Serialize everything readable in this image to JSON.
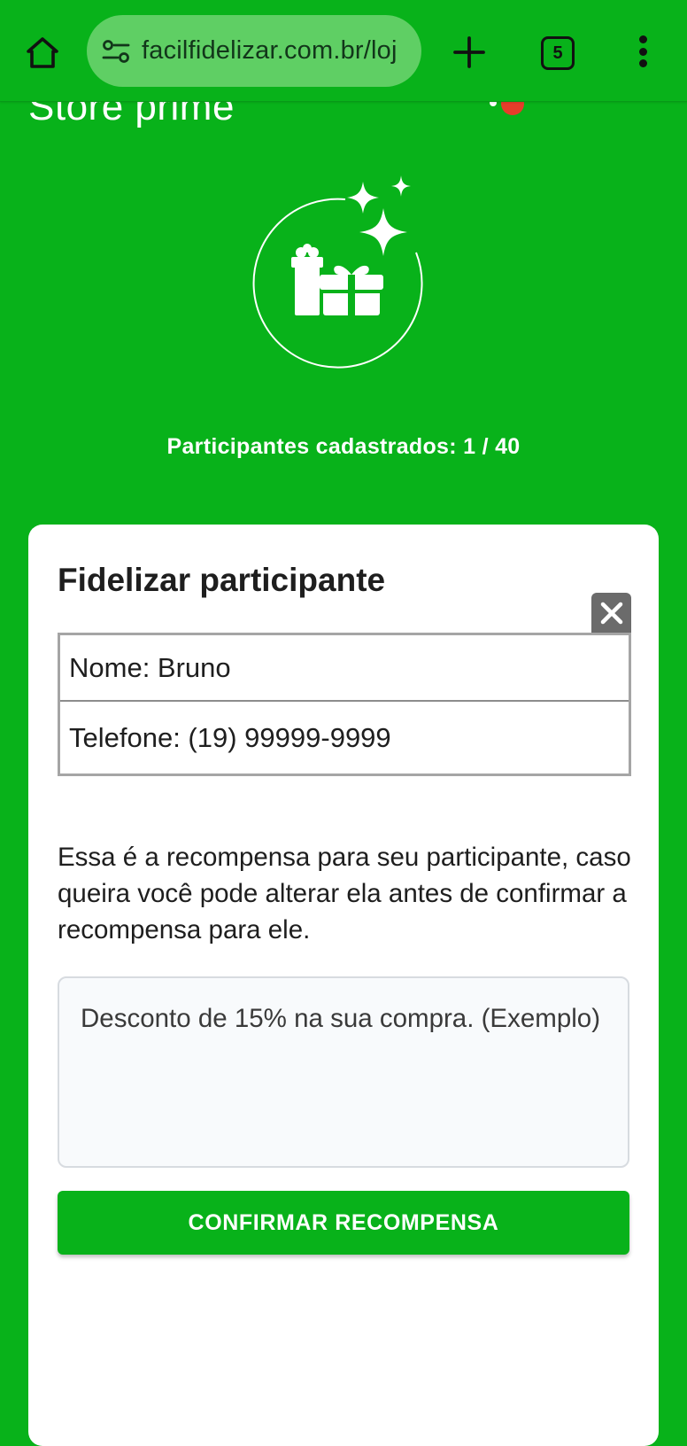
{
  "browser": {
    "url": "facilfidelizar.com.br/loj",
    "tab_count": "5"
  },
  "page": {
    "store_name": "Store prime",
    "participants_label": "Participantes cadastrados: ",
    "participants_count": "1 / 40"
  },
  "card": {
    "title": "Fidelizar participante",
    "name_row": "Nome: Bruno",
    "phone_row": "Telefone: (19) 99999-9999",
    "description": "Essa é a recompensa para seu participante, caso queira você pode alterar ela antes de confirmar a recompensa para ele.",
    "reward_text": "Desconto de 15% na sua compra. (Exemplo)",
    "confirm_label": "CONFIRMAR RECOMPENSA"
  },
  "colors": {
    "brand_green": "#08b21a",
    "url_pill": "#5fcf64",
    "notification_red": "#e53d2a"
  },
  "icons": [
    "home-icon",
    "site-settings-icon",
    "plus-icon",
    "tab-switcher-icon",
    "more-vert-icon",
    "close-icon",
    "gift-icon",
    "sparkle-icon"
  ]
}
